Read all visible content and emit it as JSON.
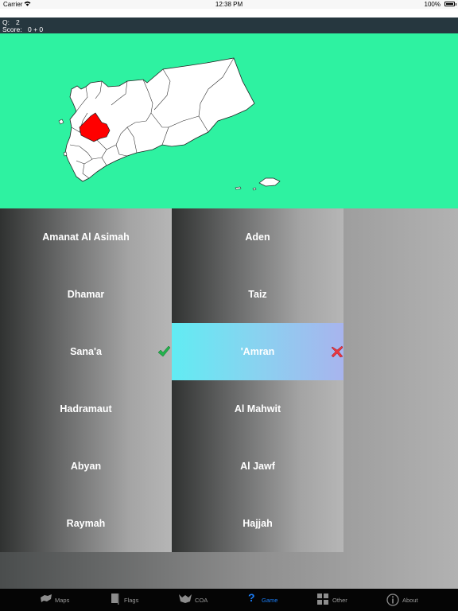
{
  "status_bar": {
    "carrier": "Carrier",
    "time": "12:38 PM",
    "battery": "100%"
  },
  "info": {
    "question_label": "Q:",
    "question_value": "2",
    "score_label": "Score:",
    "score_value": "0 + 0"
  },
  "map": {
    "land_color": "#ffffff",
    "highlight_color": "#ff0000",
    "background": "#2ef2a1"
  },
  "answers": {
    "left": [
      "Amanat Al Asimah",
      "Dhamar",
      "Sana'a",
      "Hadramaut",
      "Abyan",
      "Raymah"
    ],
    "right": [
      "Aden",
      "Taiz",
      "'Amran",
      "Al Mahwit",
      "Al Jawf",
      "Hajjah"
    ],
    "correct": "Sana'a",
    "wrong": "'Amran"
  },
  "tabs": [
    {
      "label": "Maps",
      "icon": "maps-icon"
    },
    {
      "label": "Flags",
      "icon": "flags-icon"
    },
    {
      "label": "COA",
      "icon": "coa-icon"
    },
    {
      "label": "Game",
      "icon": "game-icon",
      "active": true
    },
    {
      "label": "Other",
      "icon": "other-icon"
    },
    {
      "label": "About",
      "icon": "about-icon"
    }
  ]
}
